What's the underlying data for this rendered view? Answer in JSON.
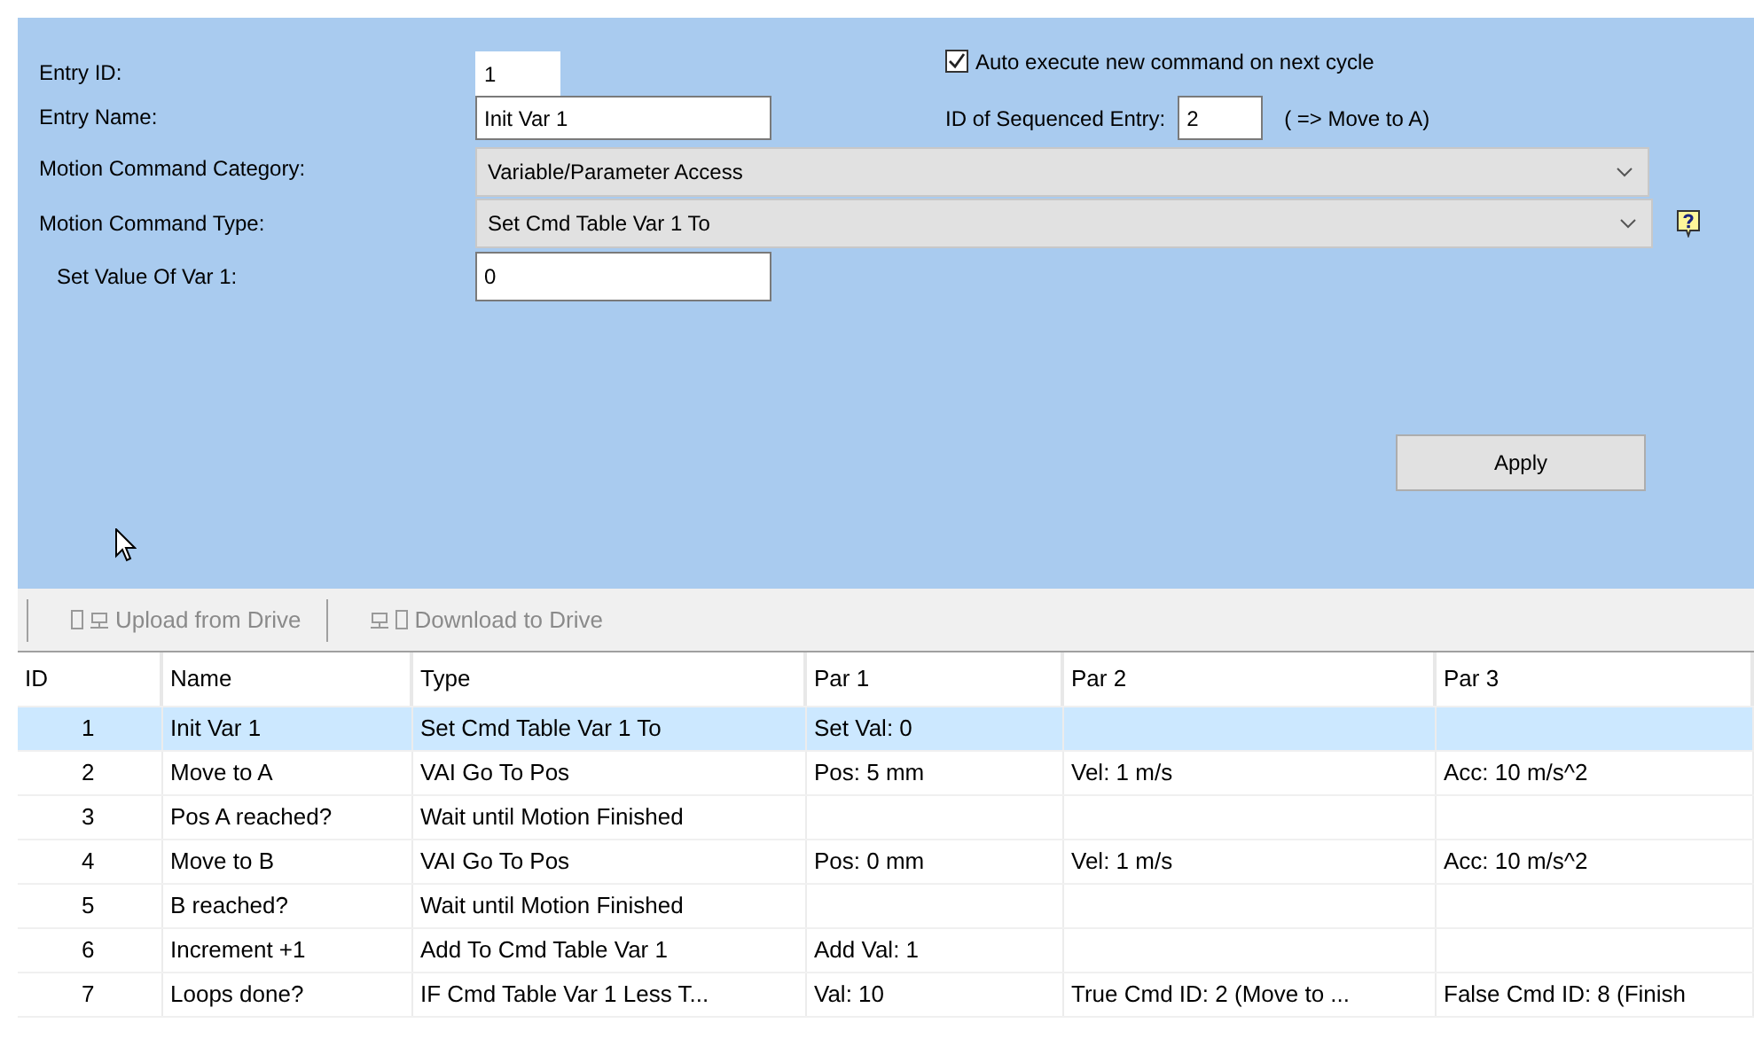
{
  "form": {
    "entry_id": {
      "label": "Entry ID:",
      "value": "1"
    },
    "entry_name": {
      "label": "Entry Name:",
      "value": "Init Var 1"
    },
    "auto_execute": {
      "label": "Auto execute new command on next cycle",
      "checked": true
    },
    "sequenced_entry": {
      "label": "ID of Sequenced Entry:",
      "value": "2",
      "hint": "( => Move to A)"
    },
    "category": {
      "label": "Motion Command Category:",
      "value": "Variable/Parameter Access"
    },
    "command_type": {
      "label": "Motion Command Type:",
      "value": "Set Cmd Table Var 1 To"
    },
    "set_value": {
      "label": "Set Value Of Var 1:",
      "value": "0"
    },
    "apply_button": "Apply"
  },
  "toolbar": [
    {
      "kind": "upload",
      "label": "Upload from Drive",
      "disabled": true
    },
    {
      "kind": "download",
      "label": "Download to Drive",
      "disabled": true
    }
  ],
  "table": {
    "columns": [
      "ID",
      "Name",
      "Type",
      "Par 1",
      "Par 2",
      "Par 3"
    ],
    "rows": [
      {
        "selected": true,
        "cells": [
          "1",
          "Init Var 1",
          "Set Cmd Table Var 1 To",
          "Set Val: 0",
          "",
          ""
        ]
      },
      {
        "selected": false,
        "cells": [
          "2",
          "Move to A",
          "VAI Go To Pos",
          "Pos: 5 mm",
          "Vel: 1 m/s",
          "Acc: 10 m/s^2"
        ]
      },
      {
        "selected": false,
        "cells": [
          "3",
          "Pos A reached?",
          "Wait until Motion Finished",
          "",
          "",
          ""
        ]
      },
      {
        "selected": false,
        "cells": [
          "4",
          "Move to B",
          "VAI Go To Pos",
          "Pos: 0 mm",
          "Vel: 1 m/s",
          "Acc: 10 m/s^2"
        ]
      },
      {
        "selected": false,
        "cells": [
          "5",
          "B reached?",
          "Wait until Motion Finished",
          "",
          "",
          ""
        ]
      },
      {
        "selected": false,
        "cells": [
          "6",
          "Increment +1",
          "Add To Cmd Table Var 1",
          "Add Val: 1",
          "",
          ""
        ]
      },
      {
        "selected": false,
        "cells": [
          "7",
          "Loops done?",
          "IF Cmd Table Var 1 Less T...",
          "Val: 10",
          "True Cmd ID: 2 (Move to ...",
          "False Cmd ID: 8 (Finish"
        ]
      }
    ]
  }
}
